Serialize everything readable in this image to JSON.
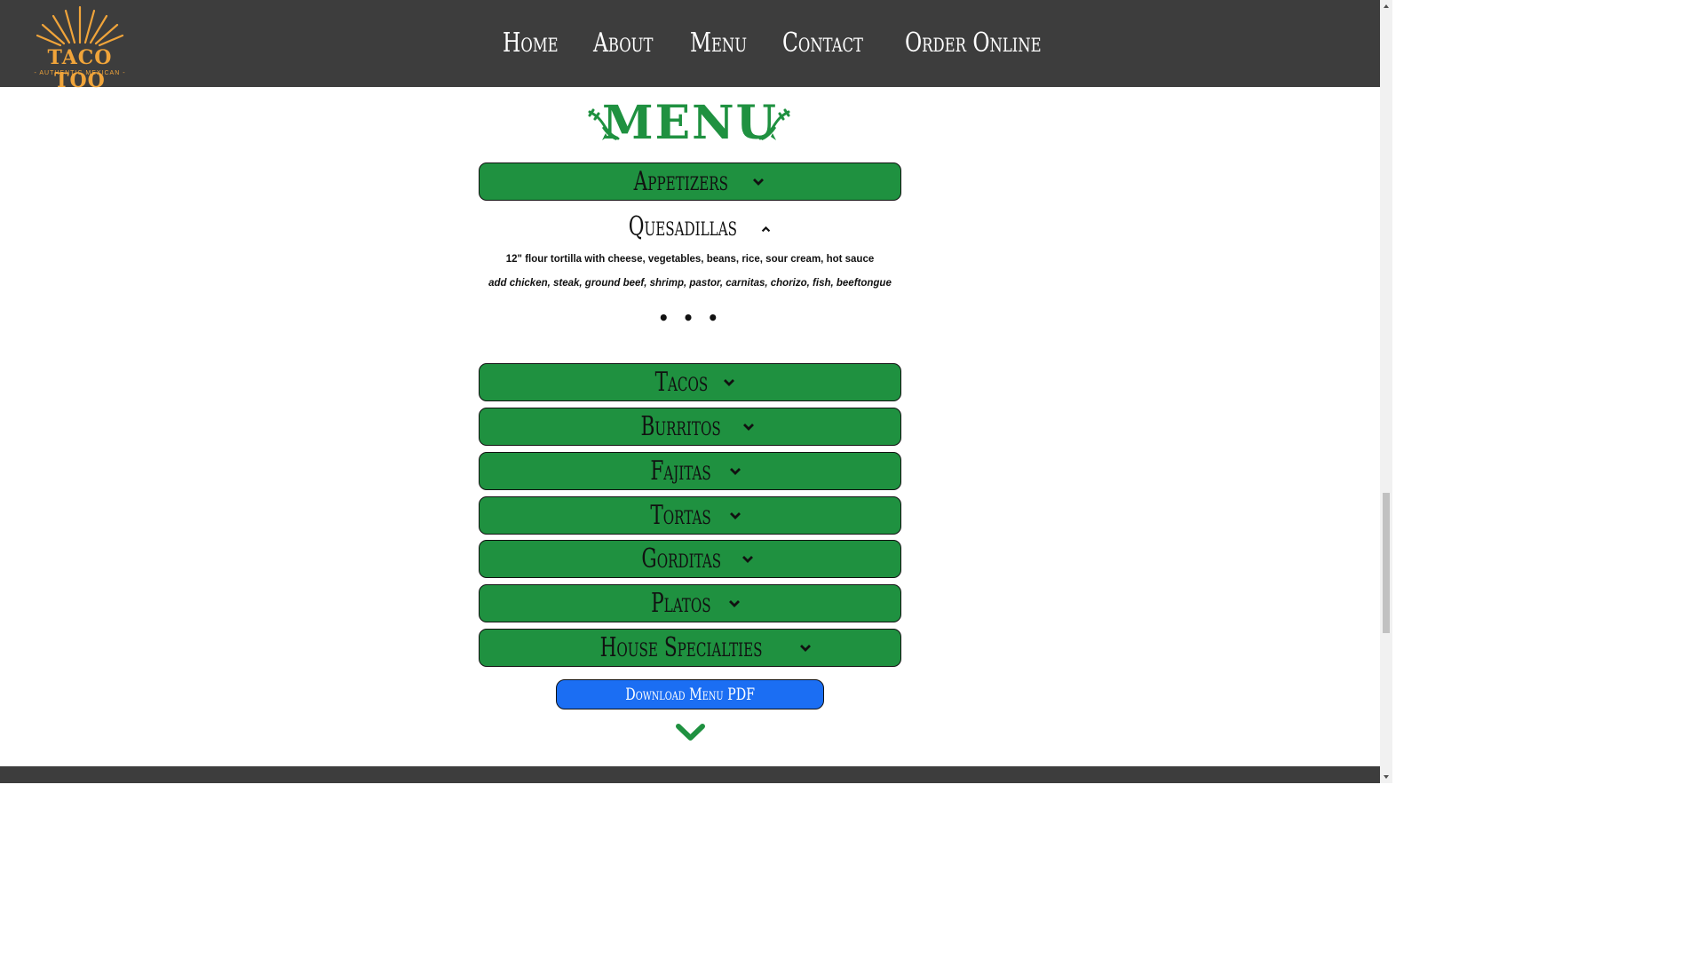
{
  "brand": {
    "name": "TACO TOO",
    "tagline": "- AUTHENTIC MEXICAN -",
    "color": "#f0a43a"
  },
  "nav": {
    "items": [
      "Home",
      "About",
      "Menu",
      "Contact",
      "Order Online"
    ]
  },
  "menu": {
    "title": "MENU",
    "accent_color": "#1f9140",
    "sections": {
      "appetizers": "Appetizers",
      "quesadillas": "Quesadillas",
      "tacos": "Tacos",
      "burritos": "Burritos",
      "fajitas": "Fajitas",
      "tortas": "Tortas",
      "gorditas": "Gorditas",
      "platos": "Platos",
      "house_specialties": "House Specialties"
    },
    "quesadillas": {
      "description": "12\" flour tortilla with cheese, vegetables, beans, rice, sour cream, hot sauce",
      "addons": "add chicken, steak, ground beef, shrimp, pastor, carnitas, chorizo, fish, beeftongue",
      "more": "• • •"
    },
    "download_label": "Download Menu PDF",
    "download_color": "#1b6ef3"
  }
}
